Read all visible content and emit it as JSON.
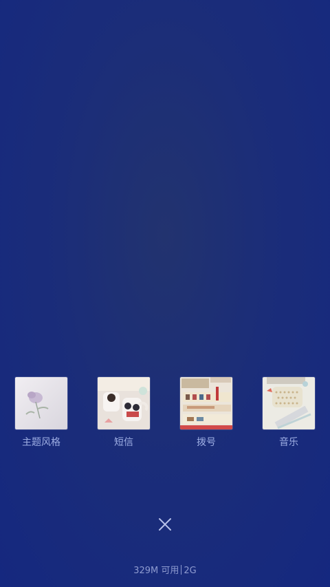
{
  "recent_apps": [
    {
      "label": "主题风格",
      "thumb_icon": "theme-thumbnail-icon"
    },
    {
      "label": "短信",
      "thumb_icon": "messages-thumbnail-icon"
    },
    {
      "label": "拨号",
      "thumb_icon": "dialer-thumbnail-icon"
    },
    {
      "label": "音乐",
      "thumb_icon": "music-thumbnail-icon"
    }
  ],
  "close": {
    "icon": "close-icon"
  },
  "status": {
    "memory": "329M 可用",
    "network": "2G"
  },
  "colors": {
    "background": "#1b2d79",
    "text": "#9eaee3"
  }
}
